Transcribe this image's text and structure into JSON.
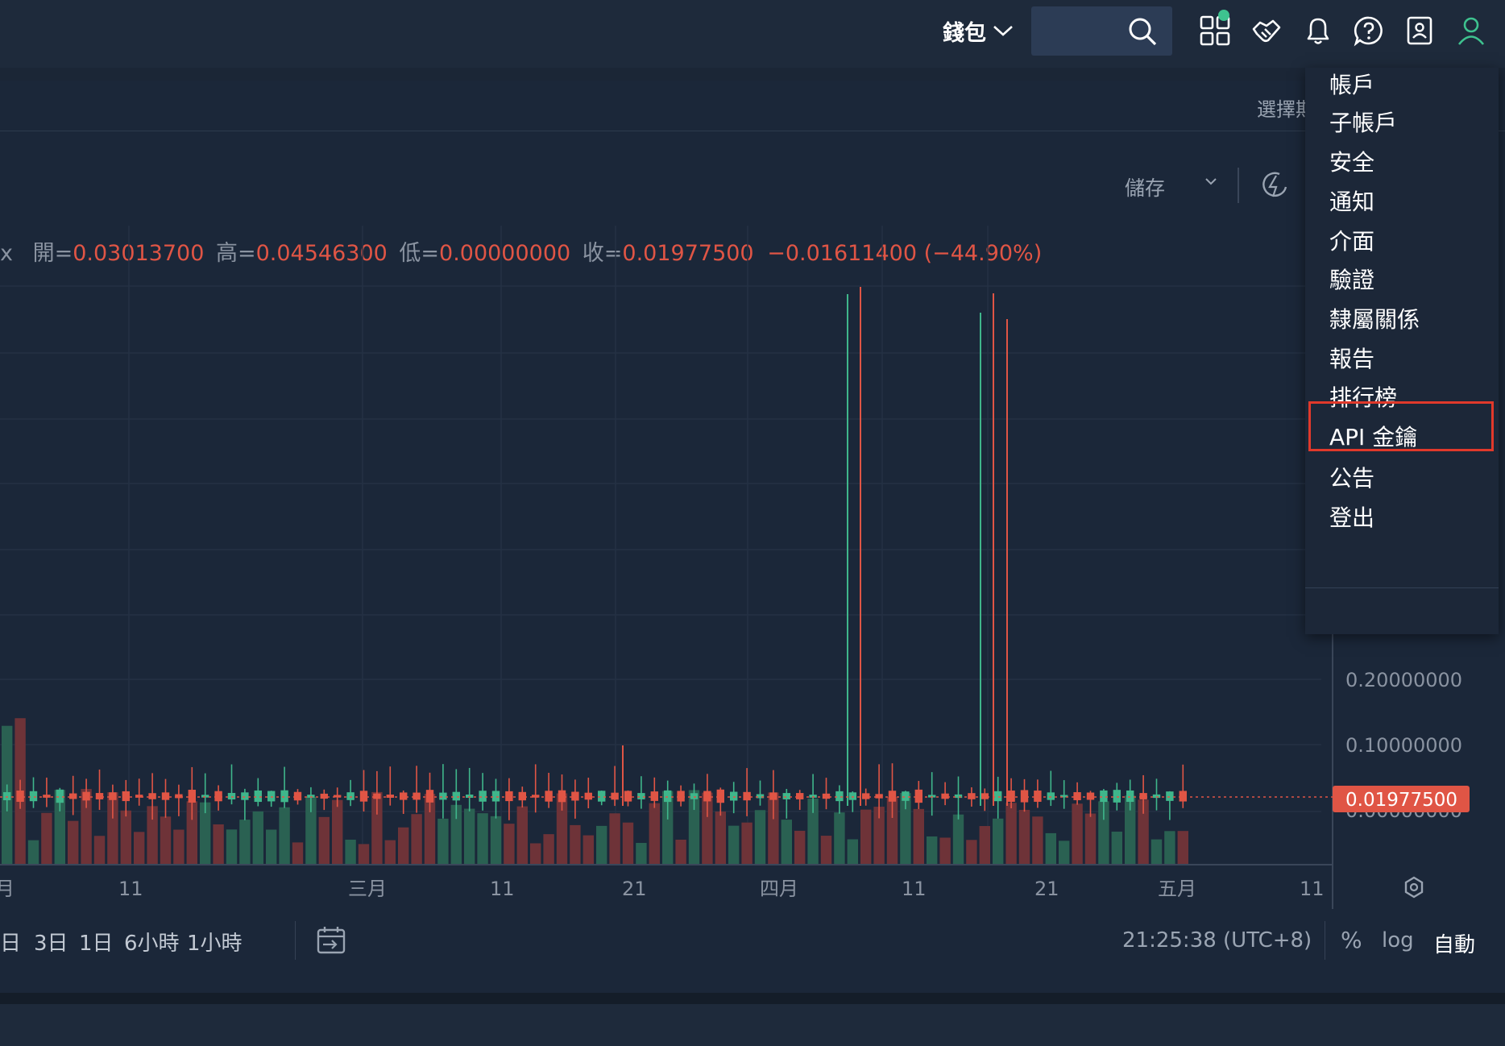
{
  "topbar": {
    "wallet_label": "錢包",
    "icons": [
      "apps-icon",
      "handshake-icon",
      "bell-icon",
      "help-icon",
      "contact-card-icon",
      "user-icon"
    ],
    "apps_badge_color": "#3ec28f"
  },
  "chart_header": {
    "select_period_label": "選擇期",
    "save_label": "儲存"
  },
  "legend": {
    "prefix": "x",
    "open_label": "開=",
    "open_value": "0.03013700",
    "high_label": "高=",
    "high_value": "0.04546300",
    "low_label": "低=",
    "low_value": "0.00000000",
    "close_label": "收=",
    "close_value": "0.01977500",
    "change": "−0.01611400 (−44.90%)"
  },
  "chart_data": {
    "type": "candlestick",
    "x_ticks": [
      "月",
      "11",
      "三月",
      "11",
      "21",
      "四月",
      "11",
      "21",
      "五月",
      "11"
    ],
    "y_ticks": [
      "0.20000000",
      "0.10000000",
      "0.00000000"
    ],
    "last_price_label": "0.01977500",
    "up_color": "#3fb68b",
    "down_color": "#e05545",
    "volume_up_color": "#2a6152",
    "volume_down_color": "#6e3338"
  },
  "bottom_toolbar": {
    "timeframes": [
      "日",
      "3日",
      "1日",
      "6小時",
      "1小時"
    ],
    "clock": "21:25:38 (UTC+8)",
    "percent": "%",
    "log": "log",
    "auto": "自動"
  },
  "account_menu": {
    "items": [
      "帳戶",
      "子帳戶",
      "安全",
      "通知",
      "介面",
      "驗證",
      "隸屬關係",
      "報告",
      "排行榜",
      "API 金鑰",
      "公告",
      "登出"
    ],
    "highlighted": "API 金鑰",
    "highlight_color": "#e0392b"
  }
}
